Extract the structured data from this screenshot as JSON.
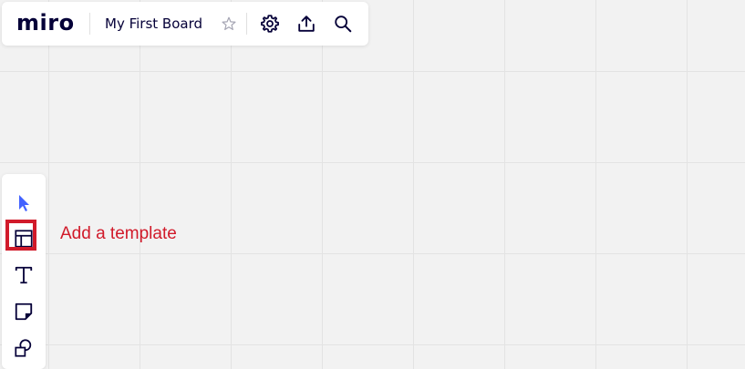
{
  "app": {
    "logo_text": "miro",
    "board_title": "My First Board"
  },
  "topbar": {
    "icons": [
      "star-icon",
      "gear-icon",
      "upload-icon",
      "search-icon"
    ]
  },
  "toolbar": {
    "tools": [
      "select-cursor-icon",
      "template-icon",
      "text-icon",
      "sticky-note-icon",
      "shapes-icon"
    ],
    "highlighted_tool": "template-icon"
  },
  "annotation": {
    "text": "Add a template"
  },
  "colors": {
    "canvas": "#f2f2f2",
    "grid": "#e3e3e3",
    "brand_dark": "#050038",
    "cursor_blue": "#4262ff",
    "annotation_red": "#d11a2a"
  }
}
